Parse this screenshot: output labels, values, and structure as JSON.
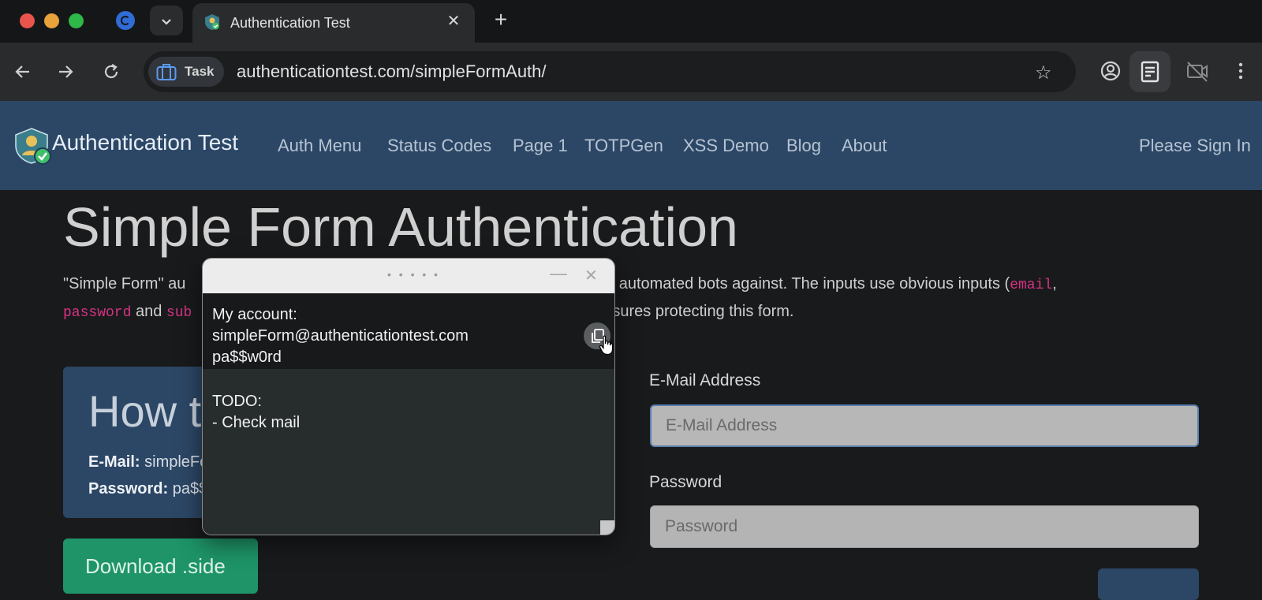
{
  "browser": {
    "tab_title": "Authentication Test",
    "new_tab_symbol": "+",
    "tab_close_symbol": "✕",
    "task_label": "Task",
    "url": "authenticationtest.com/simpleFormAuth/",
    "icons": [
      "back-arrow-icon",
      "forward-arrow-icon",
      "reload-icon",
      "briefcase-icon",
      "star-icon",
      "account-icon",
      "reading-mode-icon",
      "camera-off-icon",
      "more-vert-icon",
      "chevron-down-icon"
    ]
  },
  "site_nav": {
    "brand": "Authentication Test",
    "links": [
      "Auth Menu",
      "Status Codes",
      "Page 1",
      "TOTPGen",
      "XSS Demo",
      "Blog",
      "About"
    ],
    "signin": "Please Sign In"
  },
  "page": {
    "title": "Simple Form Authentication",
    "desc_line1_a": "\"Simple Form\" au",
    "desc_line1_b": "rite automated bots against. The inputs use obvious inputs (",
    "code_email": "email",
    "desc_comma": ",",
    "code_password": "password",
    "desc_and": " and ",
    "code_sub": "sub",
    "desc_line2_b": "re also no other additional security measures protecting this form.",
    "howto_title": "How to log in:",
    "email_label": "E-Mail:",
    "email_value": "simpleForm@authenticationtest.com",
    "password_label": "Password:",
    "password_value": "pa$$w0rd",
    "download_label": "Download .side",
    "form_email_label": "E-Mail Address",
    "form_email_placeholder": "E-Mail Address",
    "form_password_label": "Password",
    "form_password_placeholder": "Password"
  },
  "note": {
    "line1": "My account:",
    "line2": "simpleForm@authenticationtest.com",
    "line3": "pa$$w0rd",
    "line4": "TODO:",
    "line5": "- Check mail",
    "grip": "• • • • •",
    "min_symbol": "—",
    "close_symbol": "✕"
  },
  "colors": {
    "nav_bg": "#2c4766",
    "download_bg": "#1e9468",
    "code_pink": "#d63384"
  }
}
